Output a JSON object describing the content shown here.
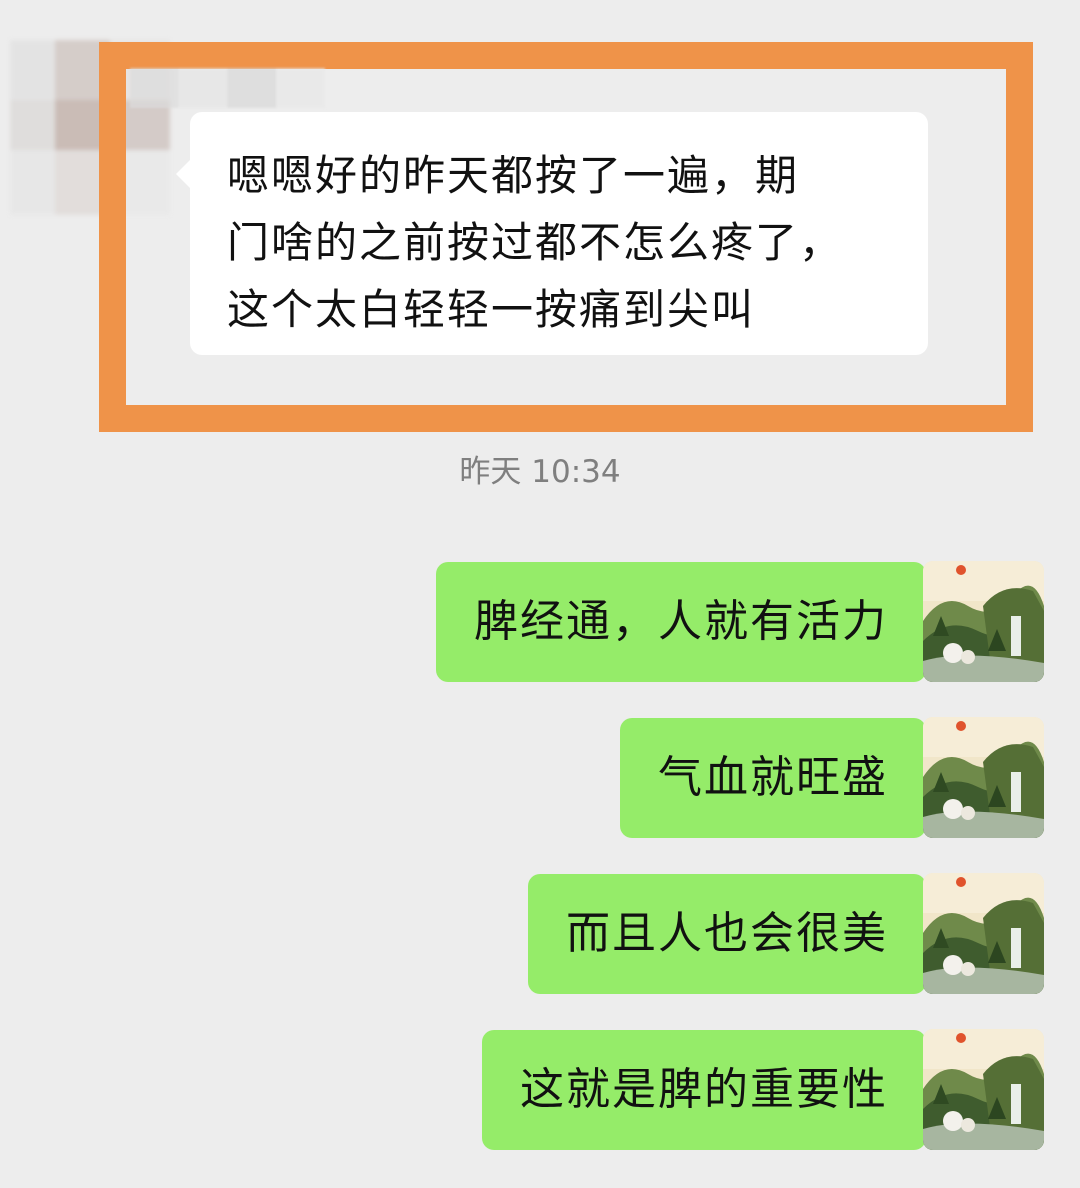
{
  "conversation": {
    "incoming": {
      "lines": [
        "嗯嗯好的昨天都按了一遍，期",
        "门啥的之前按过都不怎么疼了，",
        "这个太白轻轻一按痛到尖叫"
      ]
    },
    "timestamp": "昨天 10:34",
    "outgoing": [
      {
        "text": "脾经通，人就有活力"
      },
      {
        "text": "气血就旺盛"
      },
      {
        "text": "而且人也会很美"
      },
      {
        "text": "这就是脾的重要性"
      }
    ]
  },
  "colors": {
    "background": "#ededed",
    "incoming_bubble": "#ffffff",
    "outgoing_bubble": "#95ec69",
    "highlight_frame": "#ef9349",
    "timestamp_text": "#7f7f7f"
  },
  "icons": {
    "sender_avatar": "blurred-avatar",
    "self_avatar": "landscape-painting-avatar"
  }
}
